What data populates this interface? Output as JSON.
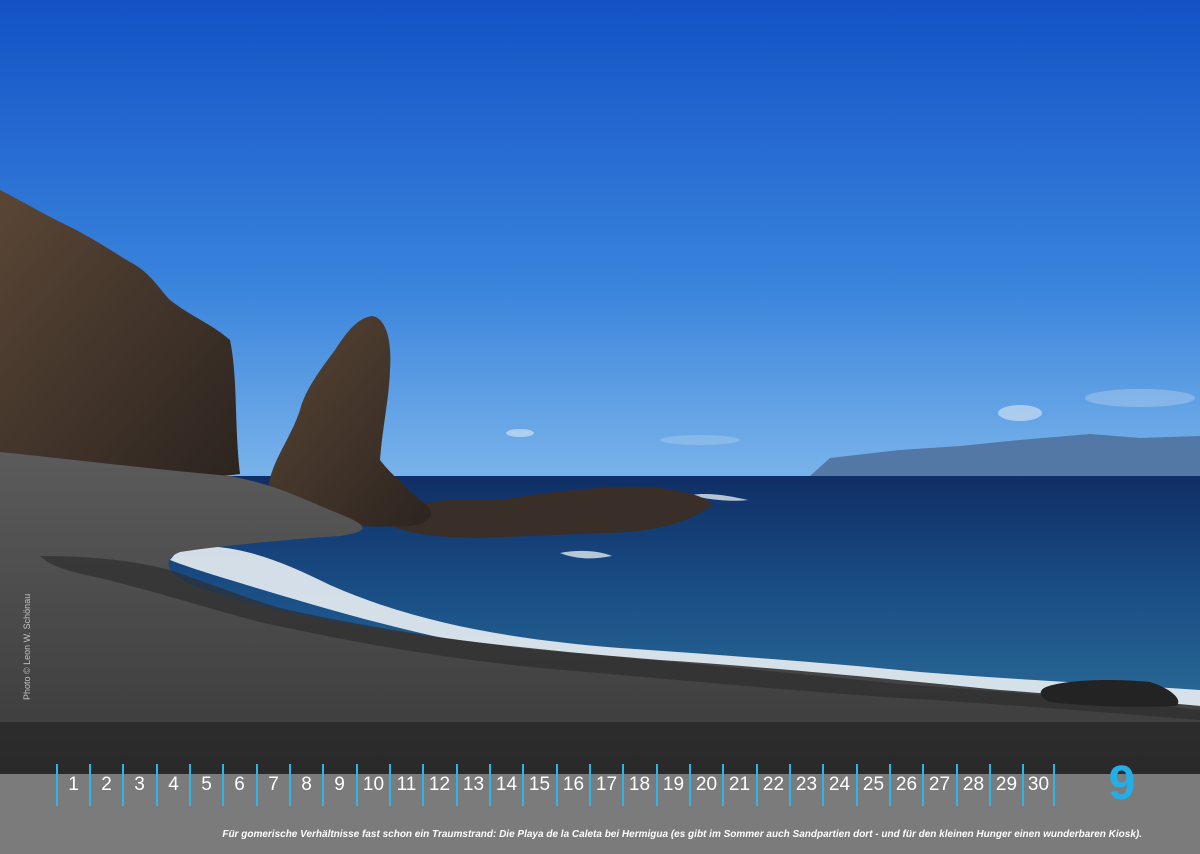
{
  "photo": {
    "credit": "Photo © Leon W. Schönau",
    "colors": {
      "sky_top": "#1357c9",
      "sky_bottom": "#5aa0e6",
      "sea": "#17457e",
      "rock": "#3b302a",
      "pebbles": "#5a5a5a"
    }
  },
  "calendar": {
    "days": [
      "1",
      "2",
      "3",
      "4",
      "5",
      "6",
      "7",
      "8",
      "9",
      "10",
      "11",
      "12",
      "13",
      "14",
      "15",
      "16",
      "17",
      "18",
      "19",
      "20",
      "21",
      "22",
      "23",
      "24",
      "25",
      "26",
      "27",
      "28",
      "29",
      "30"
    ],
    "month_number": "9",
    "accent_color": "#22aee6",
    "strip_color": "#7b7b7b"
  },
  "caption": "Für gomerische Verhältnisse fast schon ein Traumstrand: Die Playa de la Caleta bei Hermigua (es gibt im Sommer auch Sandpartien dort - und für den kleinen Hunger einen wunderbaren Kiosk)."
}
